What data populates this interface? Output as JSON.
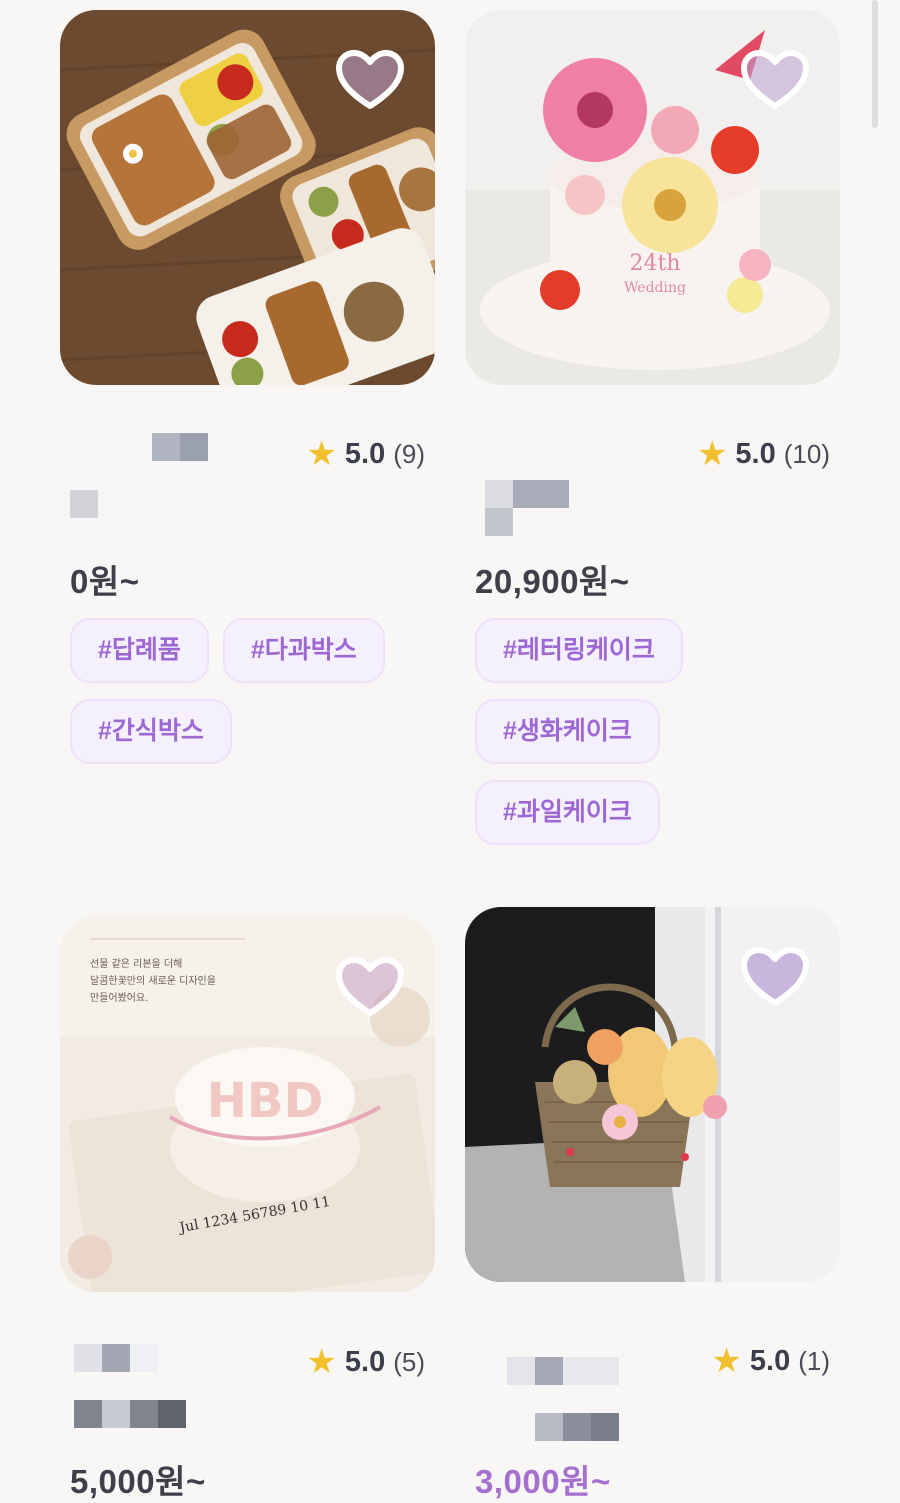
{
  "products": [
    {
      "image": "snack-box-photo",
      "rating": "5.0",
      "review_count": "(9)",
      "price": "0원~",
      "price_color": "#3f3f4a",
      "tags": [
        "#답례품",
        "#다과박스",
        "#간식박스"
      ],
      "liked": false
    },
    {
      "image": "flower-cake-photo",
      "rating": "5.0",
      "review_count": "(10)",
      "price": "20,900원~",
      "price_color": "#3f3f4a",
      "tags": [
        "#레터링케이크",
        "#생화케이크",
        "#과일케이크"
      ],
      "liked": false
    },
    {
      "image": "hbd-cake-photo",
      "photo_text": {
        "caption": "선물 같은 리본을 더해\n달콤한꽃만의 새로운 디자인을\n만들어봤어요.",
        "cake_text": "HBD",
        "board_text": "Jul 1234 56789 10 11"
      },
      "rating": "5.0",
      "review_count": "(5)",
      "price": "5,000원~",
      "price_color": "#3f3f4a",
      "tags": [],
      "liked": false
    },
    {
      "image": "fruit-basket-photo",
      "rating": "5.0",
      "review_count": "(1)",
      "price": "3,000원~",
      "price_color": "#a56fd0",
      "tags": [],
      "liked": true
    }
  ],
  "colors": {
    "accent": "#a56fd0",
    "tag_text": "#9d68d4",
    "tag_bg": "#f5f0fd",
    "star": "#f2c02c"
  },
  "icons": [
    "heart-icon",
    "star-icon"
  ]
}
